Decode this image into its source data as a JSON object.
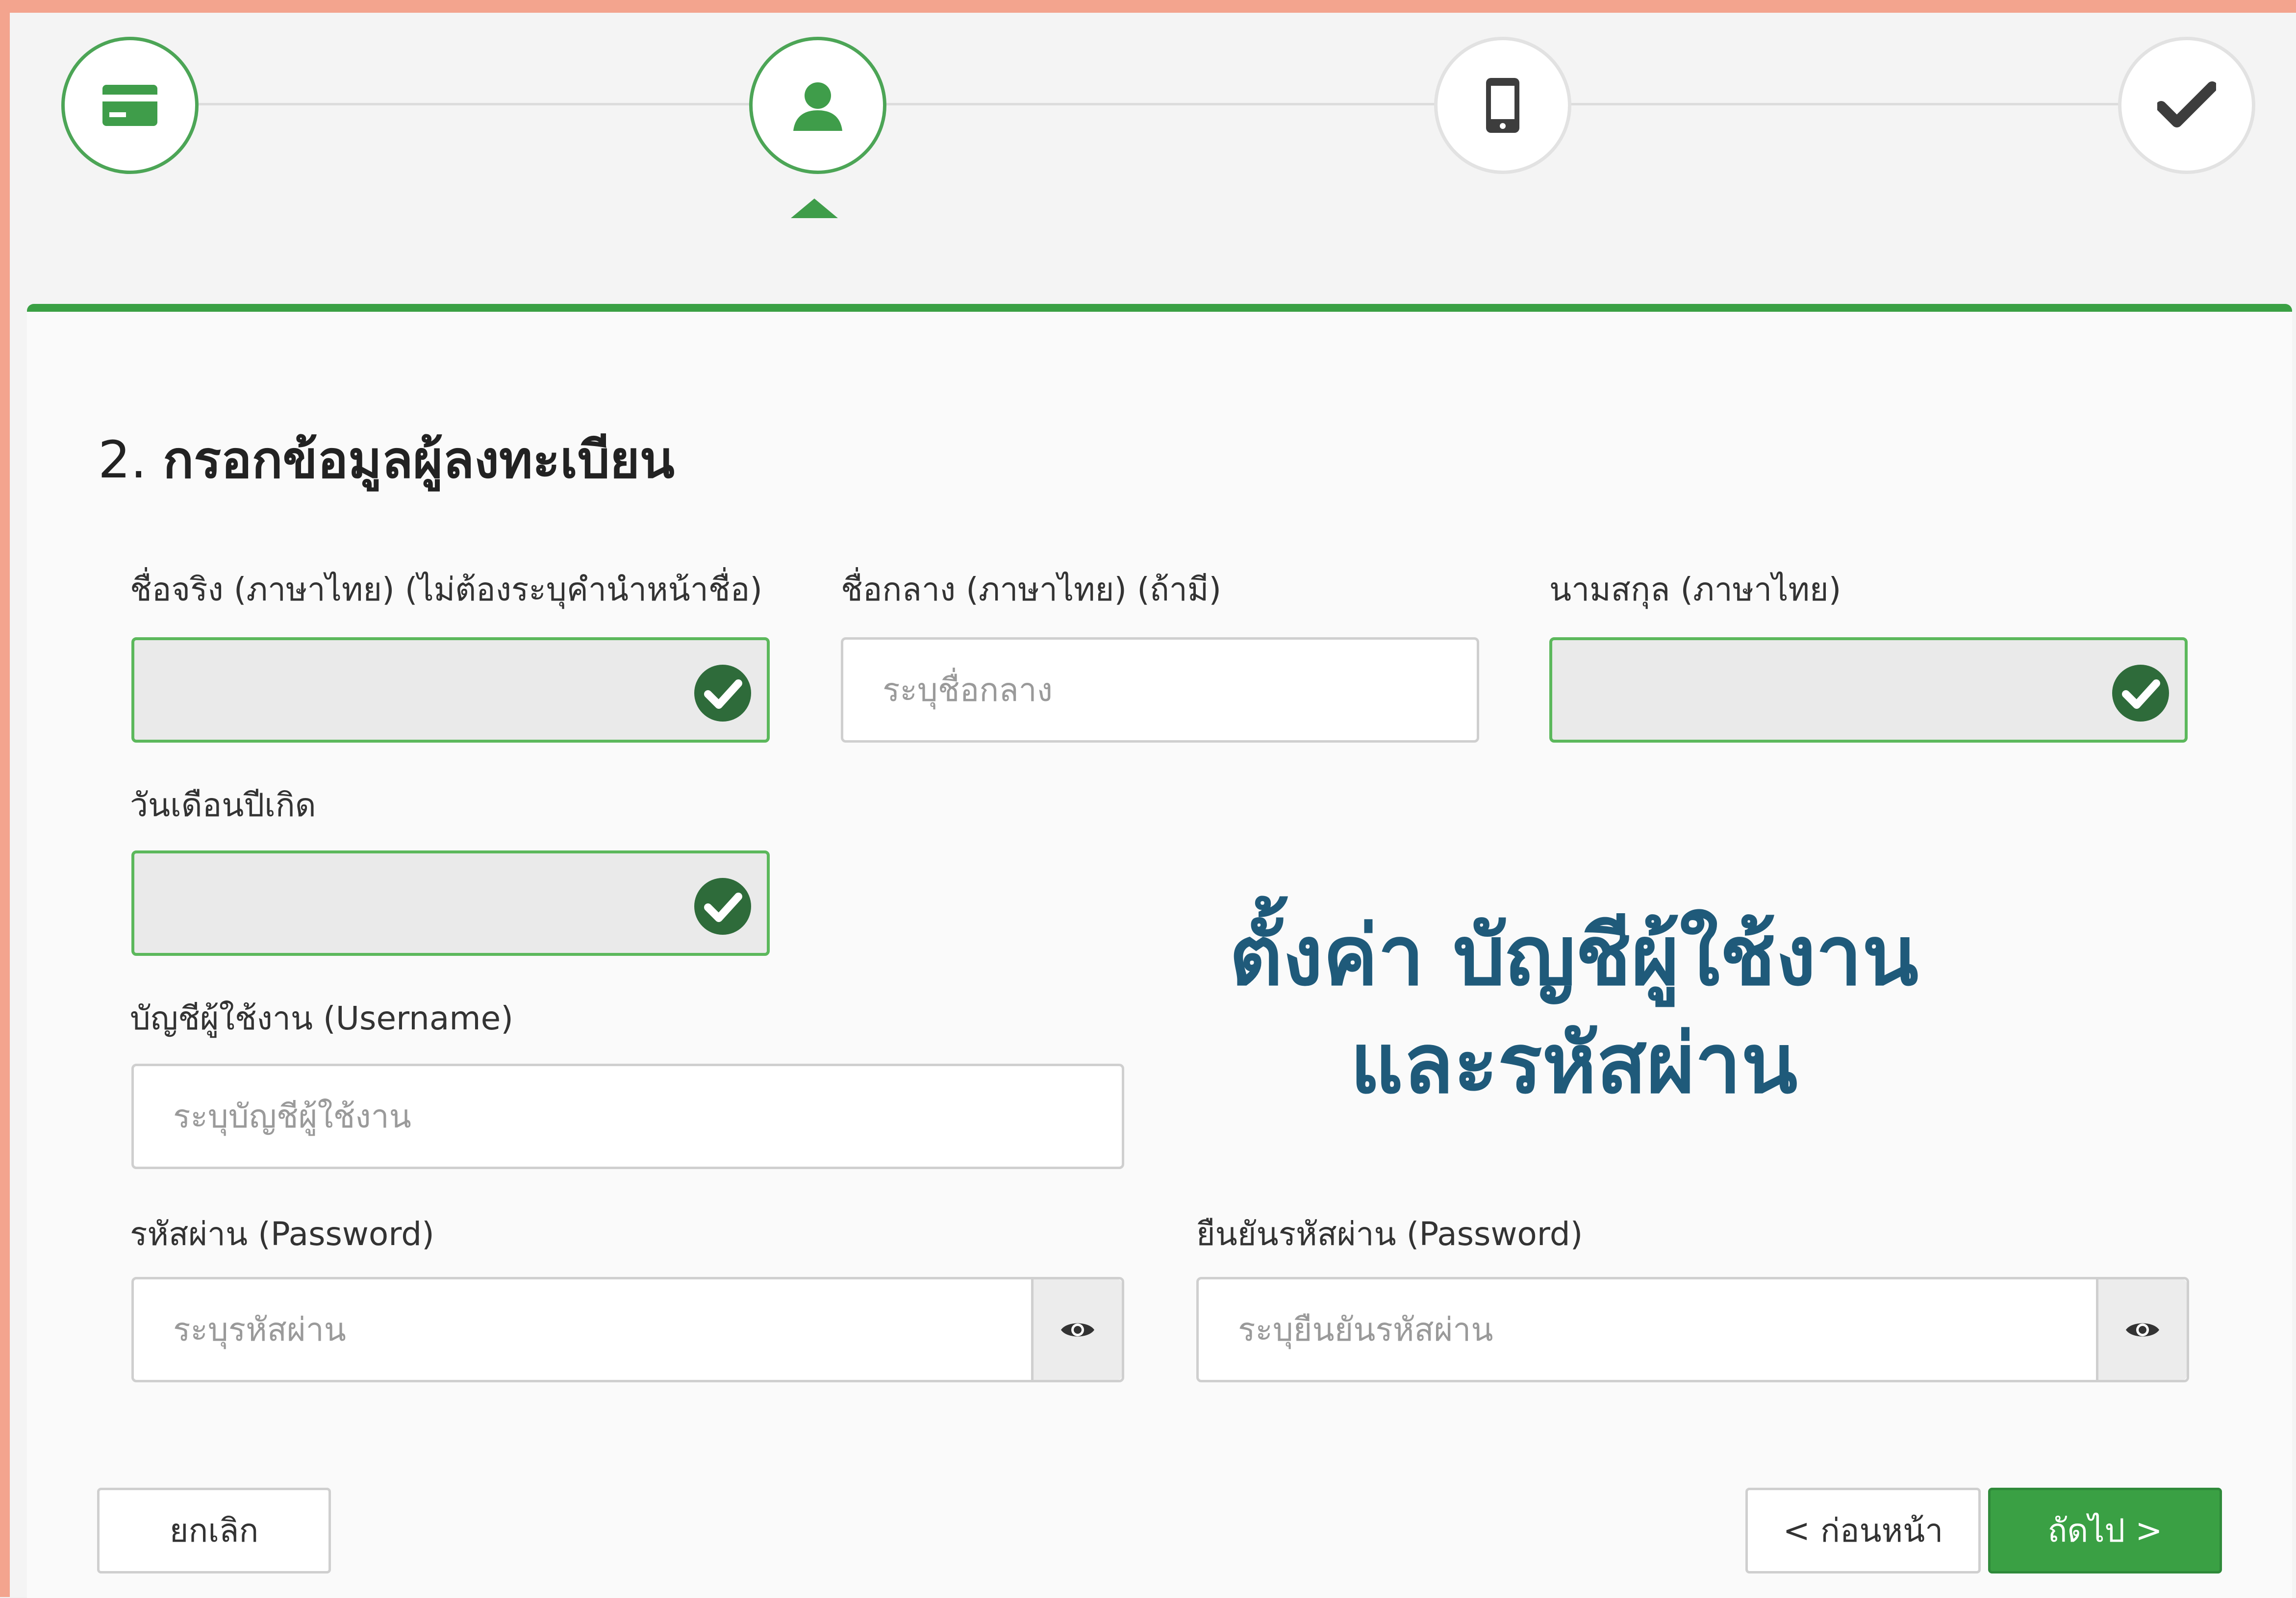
{
  "stepper": {
    "steps": [
      {
        "icon": "card-icon",
        "state": "done"
      },
      {
        "icon": "user-icon",
        "state": "current"
      },
      {
        "icon": "mobile-phone-icon",
        "state": "todo"
      },
      {
        "icon": "checkmark-icon",
        "state": "todo"
      }
    ],
    "accent_color": "#3aa044"
  },
  "form": {
    "title_number": "2.",
    "title_text": "กรอกข้อมูลผู้ลงทะเบียน",
    "first_name": {
      "label": "ชื่อจริง (ภาษาไทย) (ไม่ต้องระบุคำนำหน้าชื่อ)",
      "value": "",
      "placeholder": ""
    },
    "middle_name": {
      "label": "ชื่อกลาง (ภาษาไทย) (ถ้ามี)",
      "value": "",
      "placeholder": "ระบุชื่อกลาง"
    },
    "last_name": {
      "label": "นามสกุล (ภาษาไทย)",
      "value": "",
      "placeholder": ""
    },
    "birth_date": {
      "label": "วันเดือนปีเกิด",
      "value": "",
      "placeholder": ""
    },
    "username": {
      "label": "บัญชีผู้ใช้งาน (Username)",
      "value": "",
      "placeholder": "ระบุบัญชีผู้ใช้งาน"
    },
    "password": {
      "label": "รหัสผ่าน (Password)",
      "value": "",
      "placeholder": "ระบุรหัสผ่าน"
    },
    "confirm_password": {
      "label": "ยืนยันรหัสผ่าน (Password)",
      "value": "",
      "placeholder": "ระบุยืนยันรหัสผ่าน"
    }
  },
  "overlay": {
    "line1": "ตั้งค่า บัญชีผู้ใช้งาน",
    "line2": "และรหัสผ่าน"
  },
  "buttons": {
    "cancel": "ยกเลิก",
    "back": "< ก่อนหน้า",
    "next": "ถัดไป >"
  }
}
